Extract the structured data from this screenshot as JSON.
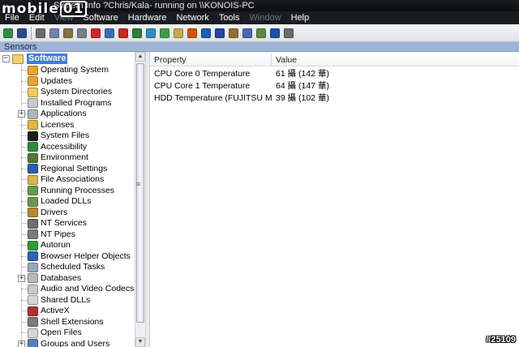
{
  "window": {
    "title": "System Info ?Chris/Kala- running on \\\\KONOIS-PC",
    "watermark_left": "mobile",
    "watermark_right": "01"
  },
  "menu": {
    "items": [
      {
        "label": "File",
        "enabled": true
      },
      {
        "label": "Edit",
        "enabled": true
      },
      {
        "label": "View",
        "enabled": false
      },
      {
        "label": "Software",
        "enabled": true
      },
      {
        "label": "Hardware",
        "enabled": true
      },
      {
        "label": "Network",
        "enabled": true
      },
      {
        "label": "Tools",
        "enabled": true
      },
      {
        "label": "Window",
        "enabled": false
      },
      {
        "label": "Help",
        "enabled": true
      }
    ]
  },
  "toolbar": {
    "icons": [
      {
        "name": "refresh-icon",
        "color": "#2f8f3b"
      },
      {
        "name": "save-icon",
        "color": "#2b4a8a"
      },
      {
        "name": "separator"
      },
      {
        "name": "cut-icon",
        "color": "#6b6b6b"
      },
      {
        "name": "copy-icon",
        "color": "#6d84b0"
      },
      {
        "name": "paste-icon",
        "color": "#8d7040"
      },
      {
        "name": "print-icon",
        "color": "#7a7f88"
      },
      {
        "name": "stop-icon",
        "color": "#d02525"
      },
      {
        "name": "monitor-icon",
        "color": "#3d6fb8"
      },
      {
        "name": "chip-icon",
        "color": "#c8281e"
      },
      {
        "name": "graph-icon",
        "color": "#2e7d32"
      },
      {
        "name": "globe-icon",
        "color": "#2d8fbf"
      },
      {
        "name": "sync-icon",
        "color": "#3b9e42"
      },
      {
        "name": "document-icon",
        "color": "#c9a84d"
      },
      {
        "name": "ring-icon",
        "color": "#d35400"
      },
      {
        "name": "network-icon",
        "color": "#1f5fae"
      },
      {
        "name": "shield-icon",
        "color": "#2145a0"
      },
      {
        "name": "tools-icon",
        "color": "#9c6b2e"
      },
      {
        "name": "app-icon",
        "color": "#4a67b5"
      },
      {
        "name": "disk-icon",
        "color": "#5c8a40"
      },
      {
        "name": "info-icon",
        "color": "#1d4fb3"
      },
      {
        "name": "link-icon",
        "color": "#6b6b6b"
      }
    ]
  },
  "panel": {
    "header": "Sensors"
  },
  "tree": {
    "root": {
      "label": "Software",
      "expander": "−"
    },
    "items": [
      {
        "label": "Operating System",
        "icon": "os-icon",
        "color": "#e9a532",
        "expander": ""
      },
      {
        "label": "Updates",
        "icon": "updates-icon",
        "color": "#e9a532",
        "expander": ""
      },
      {
        "label": "System Directories",
        "icon": "folder-icon",
        "color": "#f1c95c",
        "expander": ""
      },
      {
        "label": "Installed Programs",
        "icon": "programs-icon",
        "color": "#c9c9c9",
        "expander": ""
      },
      {
        "label": "Applications",
        "icon": "applications-icon",
        "color": "#b0b6c0",
        "expander": "+"
      },
      {
        "label": "Licenses",
        "icon": "license-icon",
        "color": "#e2b73a",
        "expander": ""
      },
      {
        "label": "System Files",
        "icon": "cmd-icon",
        "color": "#1c1c1c",
        "expander": ""
      },
      {
        "label": "Accessibility",
        "icon": "accessibility-icon",
        "color": "#2f8c3c",
        "expander": ""
      },
      {
        "label": "Environment",
        "icon": "environment-icon",
        "color": "#4f7a35",
        "expander": ""
      },
      {
        "label": "Regional Settings",
        "icon": "regional-icon",
        "color": "#2860b0",
        "expander": ""
      },
      {
        "label": "File Associations",
        "icon": "file-assoc-icon",
        "color": "#d8b64a",
        "expander": ""
      },
      {
        "label": "Running Processes",
        "icon": "process-icon",
        "color": "#6a9a4a",
        "expander": ""
      },
      {
        "label": "Loaded DLLs",
        "icon": "dll-icon",
        "color": "#6a9a4a",
        "expander": ""
      },
      {
        "label": "Drivers",
        "icon": "driver-icon",
        "color": "#b58b2e",
        "expander": ""
      },
      {
        "label": "NT Services",
        "icon": "services-icon",
        "color": "#6f6f6f",
        "expander": ""
      },
      {
        "label": "NT Pipes",
        "icon": "pipes-icon",
        "color": "#7a7a7a",
        "expander": ""
      },
      {
        "label": "Autorun",
        "icon": "autorun-icon",
        "color": "#2e9c3b",
        "expander": ""
      },
      {
        "label": "Browser Helper Objects",
        "icon": "browser-icon",
        "color": "#2e63b8",
        "expander": ""
      },
      {
        "label": "Scheduled Tasks",
        "icon": "tasks-icon",
        "color": "#9aa7b8",
        "expander": ""
      },
      {
        "label": "Databases",
        "icon": "database-icon",
        "color": "#b9b9b9",
        "expander": "+"
      },
      {
        "label": "Audio and Video Codecs",
        "icon": "codec-icon",
        "color": "#c9c9c9",
        "expander": ""
      },
      {
        "label": "Shared DLLs",
        "icon": "shared-dll-icon",
        "color": "#d6d6d6",
        "expander": ""
      },
      {
        "label": "ActiveX",
        "icon": "activex-icon",
        "color": "#b03030",
        "expander": ""
      },
      {
        "label": "Shell Extensions",
        "icon": "shell-icon",
        "color": "#7a7a7a",
        "expander": ""
      },
      {
        "label": "Open Files",
        "icon": "open-files-icon",
        "color": "#d6d6d6",
        "expander": ""
      },
      {
        "label": "Groups and Users",
        "icon": "users-icon",
        "color": "#5a7fb8",
        "expander": "+"
      }
    ]
  },
  "list": {
    "columns": [
      "Property",
      "Value"
    ],
    "rows": [
      {
        "property": "CPU Core 0 Temperature",
        "value": "61 攝 (142 華)"
      },
      {
        "property": "CPU Core 1 Temperature",
        "value": "64 攝 (147 華)"
      },
      {
        "property": "HDD Temperature (FUJITSU MH...",
        "value": "39 攝 (102 華)"
      }
    ]
  },
  "stamp": "#25109"
}
